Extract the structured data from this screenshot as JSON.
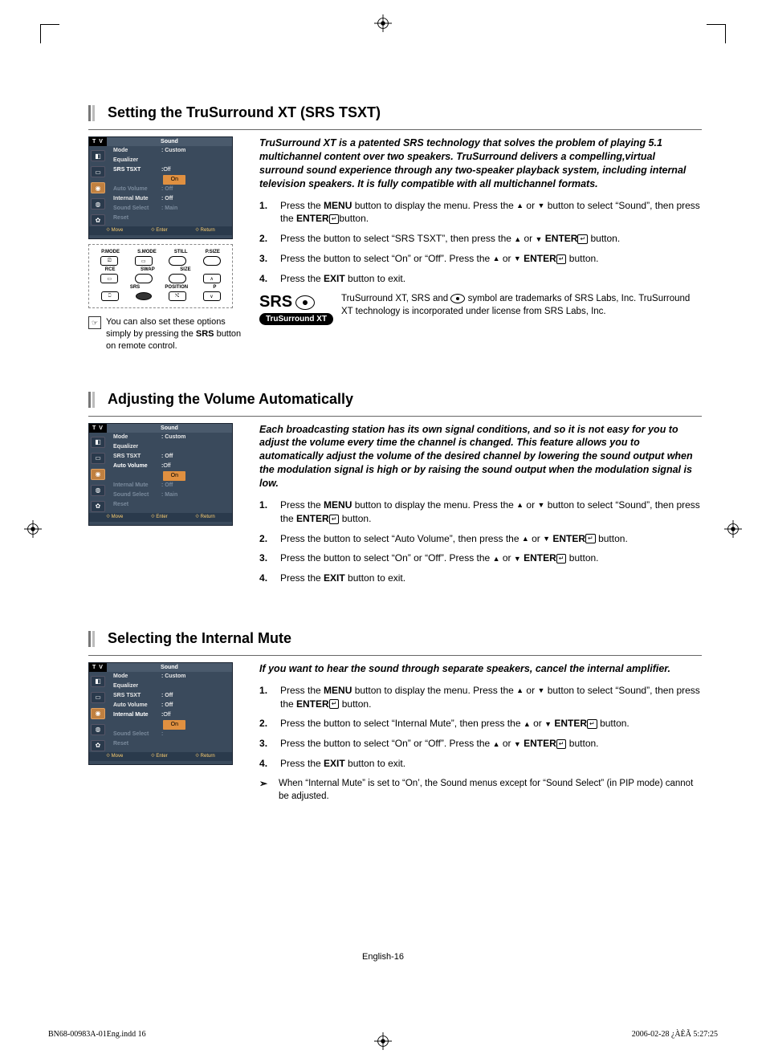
{
  "sections": [
    {
      "title": "Setting the TruSurround XT (SRS TSXT)",
      "osd": {
        "tv": "T V",
        "panel": "Sound",
        "rows": [
          {
            "label": "Mode",
            "val": ": Custom",
            "cls": ""
          },
          {
            "label": "Equalizer",
            "val": "",
            "cls": ""
          },
          {
            "label": "SRS TSXT",
            "val": ":",
            "cls": "active",
            "opts": [
              "Off",
              "On"
            ],
            "hl": 1
          },
          {
            "label": "Auto Volume",
            "val": ": Off",
            "cls": "dim"
          },
          {
            "label": "Internal Mute",
            "val": ": Off",
            "cls": ""
          },
          {
            "label": "Sound Select",
            "val": ": Main",
            "cls": "dim"
          },
          {
            "label": "Reset",
            "val": "",
            "cls": "dim"
          }
        ],
        "footer": [
          "Move",
          "Enter",
          "Return"
        ]
      },
      "remote_labels": {
        "row1": [
          "P.MODE",
          "S.MODE",
          "STILL",
          "P.SIZE"
        ],
        "row2": [
          "RCE",
          "SWAP",
          "SIZE",
          ""
        ],
        "row3": [
          "",
          "SRS",
          "POSITION",
          "P"
        ]
      },
      "note_left": "You can also set these options simply by pressing the ",
      "note_left_bold": "SRS",
      "note_left_tail": " button on remote control.",
      "intro": "TruSurround XT is a patented SRS technology that solves the problem of playing 5.1 multichannel content over two speakers. TruSurround delivers a compelling,virtual surround sound experience through any two-speaker playback system, including internal television speakers. It is fully compatible with all multichannel formats.",
      "steps": [
        {
          "pre": "Press the ",
          "b1": "MENU",
          "mid1": " button to display the menu. Press the ",
          "arrows": true,
          "mid2": " button to select “Sound”, then press the ",
          "b2": "ENTER",
          "tail": "button."
        },
        {
          "pre": "Press the ",
          "arrows": true,
          "mid1": " button to select “SRS TSXT”, then press the ",
          "b2": "ENTER",
          "tail": " button."
        },
        {
          "pre": "Press the ",
          "arrows": true,
          "mid1": " button to select “On” or “Off”. Press the ",
          "b2": "ENTER",
          "tail": " button."
        },
        {
          "pre": "Press the ",
          "b1": "EXIT",
          "tail": " button to exit."
        }
      ],
      "srs": {
        "logo_top": "SRS",
        "logo_pill": "TruSurround XT",
        "text_pre": "TruSurround XT, SRS and ",
        "text_post": " symbol are trademarks of SRS Labs, Inc. TruSurround XT technology is incorporated under license from SRS Labs, Inc."
      }
    },
    {
      "title": "Adjusting the Volume Automatically",
      "osd": {
        "tv": "T V",
        "panel": "Sound",
        "rows": [
          {
            "label": "Mode",
            "val": ": Custom",
            "cls": ""
          },
          {
            "label": "Equalizer",
            "val": "",
            "cls": ""
          },
          {
            "label": "SRS TSXT",
            "val": ": Off",
            "cls": ""
          },
          {
            "label": "Auto Volume",
            "val": ":",
            "cls": "active",
            "opts": [
              "Off",
              "On"
            ],
            "hl": 1
          },
          {
            "label": "Internal Mute",
            "val": ": Off",
            "cls": "dim"
          },
          {
            "label": "Sound Select",
            "val": ": Main",
            "cls": "dim"
          },
          {
            "label": "Reset",
            "val": "",
            "cls": "dim"
          }
        ],
        "footer": [
          "Move",
          "Enter",
          "Return"
        ]
      },
      "intro": "Each broadcasting station has its own signal conditions, and so it is not easy for you to adjust the volume every time the channel is changed. This feature allows you to automatically adjust the volume of the desired channel by lowering the sound output when the modulation signal is high or by raising the sound output when the modulation signal is low.",
      "steps": [
        {
          "pre": "Press the ",
          "b1": "MENU",
          "mid1": " button to display the menu. Press the ",
          "arrows": true,
          "mid2": " button to select “Sound”, then press the ",
          "b2": "ENTER",
          "tail": " button."
        },
        {
          "pre": "Press the ",
          "arrows": true,
          "mid1": " button to select “Auto Volume”, then press the ",
          "b2": "ENTER",
          "tail": " button."
        },
        {
          "pre": "Press the ",
          "arrows": true,
          "mid1": " button to select “On” or “Off”. Press the ",
          "b2": "ENTER",
          "tail": " button."
        },
        {
          "pre": "Press the ",
          "b1": "EXIT",
          "tail": " button to exit."
        }
      ]
    },
    {
      "title": "Selecting the Internal Mute",
      "osd": {
        "tv": "T V",
        "panel": "Sound",
        "rows": [
          {
            "label": "Mode",
            "val": ": Custom",
            "cls": ""
          },
          {
            "label": "Equalizer",
            "val": "",
            "cls": ""
          },
          {
            "label": "SRS TSXT",
            "val": ": Off",
            "cls": ""
          },
          {
            "label": "Auto Volume",
            "val": ": Off",
            "cls": ""
          },
          {
            "label": "Internal Mute",
            "val": ":",
            "cls": "active",
            "opts": [
              "Off",
              "On"
            ],
            "hl": 1
          },
          {
            "label": "Sound Select",
            "val": ":",
            "cls": "dim"
          },
          {
            "label": "Reset",
            "val": "",
            "cls": "dim"
          }
        ],
        "footer": [
          "Move",
          "Enter",
          "Return"
        ]
      },
      "intro": "If you want to hear the sound through separate speakers, cancel the internal amplifier.",
      "steps": [
        {
          "pre": "Press the ",
          "b1": "MENU",
          "mid1": " button to display the menu. Press the ",
          "arrows": true,
          "mid2": " button to select “Sound”, then press the ",
          "b2": "ENTER",
          "tail": " button."
        },
        {
          "pre": "Press the ",
          "arrows": true,
          "mid1": " button to select “Internal Mute”, then press the ",
          "b2": "ENTER",
          "tail": " button."
        },
        {
          "pre": "Press the ",
          "arrows": true,
          "mid1": " button to select “On” or “Off”. Press the ",
          "b2": "ENTER",
          "tail": " button."
        },
        {
          "pre": "Press the ",
          "b1": "EXIT",
          "tail": " button to exit."
        }
      ],
      "subnote": "When “Internal Mute” is set to “On’, the Sound menus except for “Sound Select” (in PIP mode) cannot be adjusted."
    }
  ],
  "footer": {
    "center": "English-16",
    "left": "BN68-00983A-01Eng.indd   16",
    "right": "2006-02-28   ¿ÀÈÃ 5:27:25"
  }
}
